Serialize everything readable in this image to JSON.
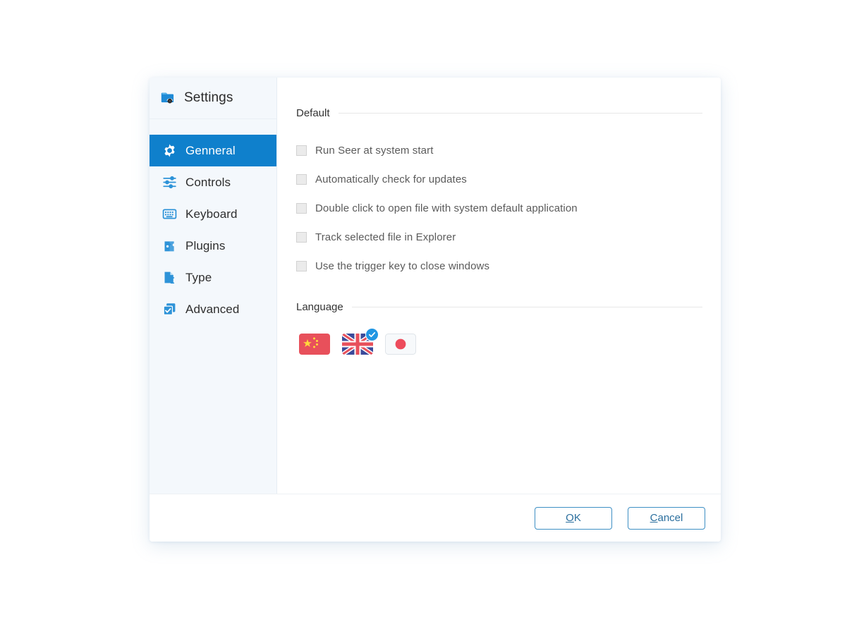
{
  "window": {
    "title": "Settings",
    "app_icon": "seer-folder-icon"
  },
  "sidebar": {
    "items": [
      {
        "label": "Genneral",
        "icon": "gear-icon",
        "active": true
      },
      {
        "label": "Controls",
        "icon": "sliders-icon",
        "active": false
      },
      {
        "label": "Keyboard",
        "icon": "keyboard-icon",
        "active": false
      },
      {
        "label": "Plugins",
        "icon": "puzzle-icon",
        "active": false
      },
      {
        "label": "Type",
        "icon": "document-text-cursor-icon",
        "active": false
      },
      {
        "label": "Advanced",
        "icon": "stacked-check-icon",
        "active": false
      }
    ]
  },
  "main": {
    "sections": [
      {
        "title": "Default",
        "options": [
          {
            "label": "Run Seer at system start",
            "checked": false
          },
          {
            "label": "Automatically check for updates",
            "checked": false
          },
          {
            "label": "Double click to open file with system default application",
            "checked": false
          },
          {
            "label": "Track selected file in Explorer",
            "checked": false
          },
          {
            "label": "Use the trigger key to close windows",
            "checked": false
          }
        ]
      },
      {
        "title": "Language",
        "languages": [
          {
            "name": "chinese-flag",
            "selected": false
          },
          {
            "name": "english-flag",
            "selected": true
          },
          {
            "name": "japanese-flag",
            "selected": false
          }
        ]
      }
    ]
  },
  "footer": {
    "ok_accel": "O",
    "ok_rest": "K",
    "cancel_accel": "C",
    "cancel_rest": "ancel"
  },
  "colors": {
    "accent": "#0f80cc",
    "icon_blue": "#2e93d8",
    "button_border": "#3e8fc4",
    "button_text": "#2b6f9e",
    "sidebar_bg": "#f4f8fc",
    "china_red": "#e8505b",
    "japan_red": "#ed4c5c",
    "uk_blue": "#3b4a9a",
    "badge_blue": "#2196e3"
  }
}
